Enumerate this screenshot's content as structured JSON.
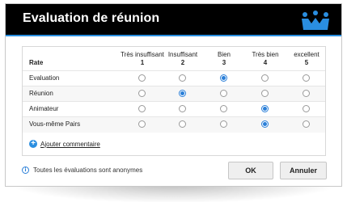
{
  "dialog": {
    "title": "Evaluation de réunion",
    "logo_icon": "people-group-icon",
    "accent_color": "#2a8ee0"
  },
  "table": {
    "rate_header": "Rate",
    "columns": [
      {
        "label": "Très insuffisant",
        "value": "1"
      },
      {
        "label": "Insuffisant",
        "value": "2"
      },
      {
        "label": "Bien",
        "value": "3"
      },
      {
        "label": "Très bien",
        "value": "4"
      },
      {
        "label": "excellent",
        "value": "5"
      }
    ],
    "rows": [
      {
        "label": "Evaluation",
        "selected": 3
      },
      {
        "label": "Réunion",
        "selected": 2
      },
      {
        "label": "Animateur",
        "selected": 4
      },
      {
        "label": "Vous-même Pairs",
        "selected": 4
      }
    ]
  },
  "add_comment": {
    "label": "Ajouter commentaire",
    "icon": "plus-circle-icon"
  },
  "footer": {
    "info_icon": "info-icon",
    "info_text": "Toutes les évaluations sont anonymes",
    "ok_label": "OK",
    "cancel_label": "Annuler"
  }
}
